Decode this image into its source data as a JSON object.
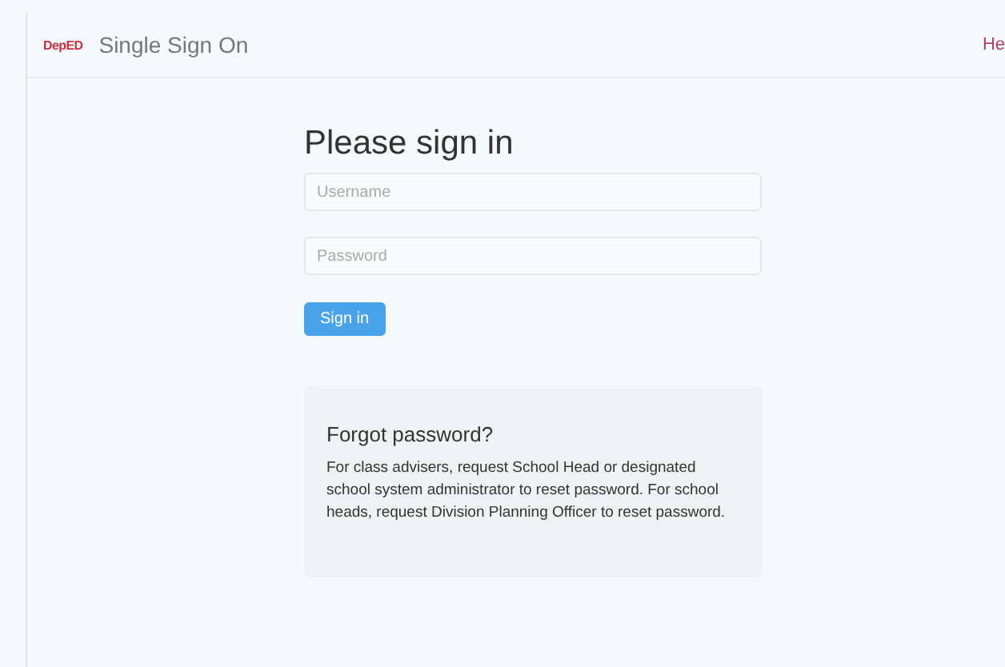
{
  "navbar": {
    "logo": "DepED",
    "title": "Single Sign On",
    "link": "He"
  },
  "form": {
    "heading": "Please sign in",
    "username": {
      "placeholder": "Username"
    },
    "password": {
      "placeholder": "Password"
    },
    "button": "Sign in"
  },
  "help": {
    "heading": "Forgot password?",
    "text": "For class advisers, request School Head or designated school system administrator to reset password. For school heads, request Division Planning Officer to reset password."
  }
}
